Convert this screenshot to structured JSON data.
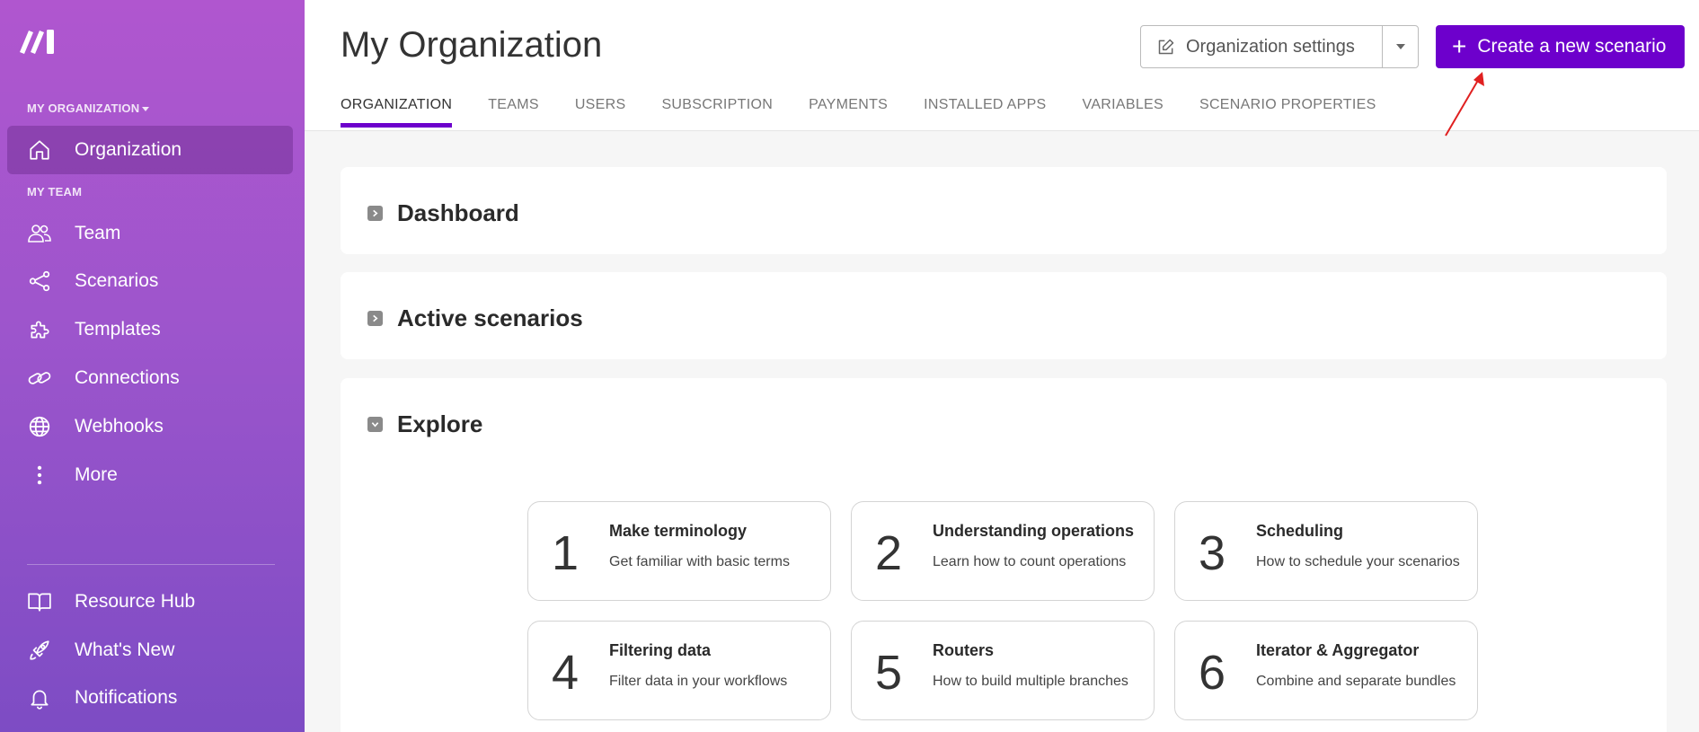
{
  "sidebar": {
    "org_label": "MY ORGANIZATION",
    "team_label": "MY TEAM",
    "items": [
      {
        "label": "Organization",
        "icon": "home-icon"
      },
      {
        "label": "Team",
        "icon": "users-icon"
      },
      {
        "label": "Scenarios",
        "icon": "share-nodes-icon"
      },
      {
        "label": "Templates",
        "icon": "puzzle-icon"
      },
      {
        "label": "Connections",
        "icon": "link-icon"
      },
      {
        "label": "Webhooks",
        "icon": "globe-icon"
      },
      {
        "label": "More",
        "icon": "more-vertical-icon"
      }
    ],
    "bottom_items": [
      {
        "label": "Resource Hub",
        "icon": "book-icon"
      },
      {
        "label": "What's New",
        "icon": "rocket-icon"
      },
      {
        "label": "Notifications",
        "icon": "bell-icon"
      }
    ]
  },
  "header": {
    "title": "My Organization",
    "tabs": [
      "ORGANIZATION",
      "TEAMS",
      "USERS",
      "SUBSCRIPTION",
      "PAYMENTS",
      "INSTALLED APPS",
      "VARIABLES",
      "SCENARIO PROPERTIES"
    ],
    "active_tab": "ORGANIZATION",
    "settings_button": "Organization settings",
    "create_button": "Create a new scenario"
  },
  "panels": {
    "dashboard": "Dashboard",
    "active_scenarios": "Active scenarios",
    "explore": "Explore"
  },
  "explore_cards": [
    {
      "num": "1",
      "title": "Make terminology",
      "desc": "Get familiar with basic terms"
    },
    {
      "num": "2",
      "title": "Understanding operations",
      "desc": "Learn how to count operations"
    },
    {
      "num": "3",
      "title": "Scheduling",
      "desc": "How to schedule your scenarios"
    },
    {
      "num": "4",
      "title": "Filtering data",
      "desc": "Filter data in your workflows"
    },
    {
      "num": "5",
      "title": "Routers",
      "desc": "How to build multiple branches"
    },
    {
      "num": "6",
      "title": "Iterator & Aggregator",
      "desc": "Combine and separate bundles"
    }
  ],
  "colors": {
    "brand": "#6d00cc",
    "sidebar_top": "#b056cf",
    "sidebar_bottom": "#7d4cc4",
    "annotation_arrow": "#e02020"
  }
}
